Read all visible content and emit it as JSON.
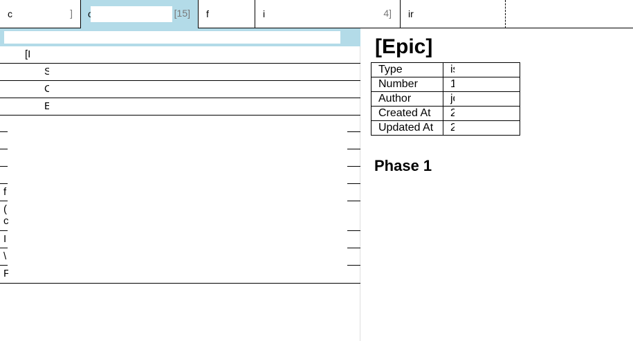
{
  "tabs": [
    {
      "label": "c",
      "count": "]"
    },
    {
      "label": "c",
      "count": "[15]"
    },
    {
      "label": "f",
      "count": ""
    },
    {
      "label": "i",
      "count": "4]"
    },
    {
      "label": "ir",
      "count": ""
    }
  ],
  "filter": {
    "value": "",
    "placeholder": ""
  },
  "list": {
    "rows": [
      {
        "label": "[I"
      },
      {
        "label": "S"
      },
      {
        "label": "C"
      },
      {
        "label": "E"
      }
    ],
    "stubs": [
      "",
      "",
      "",
      "",
      "f",
      "(",
      "c",
      "I",
      "\\",
      "F"
    ]
  },
  "detail": {
    "title": "[Epic]",
    "meta": [
      {
        "key": "Type",
        "value": "is"
      },
      {
        "key": "Number",
        "value": "1"
      },
      {
        "key": "Author",
        "value": "jo"
      },
      {
        "key": "Created At",
        "value": "2"
      },
      {
        "key": "Updated At",
        "value": "2"
      }
    ],
    "section": "Phase 1"
  },
  "colors": {
    "selected_tab": "#b3dbe8",
    "filter_bar": "#b3dbe8"
  }
}
